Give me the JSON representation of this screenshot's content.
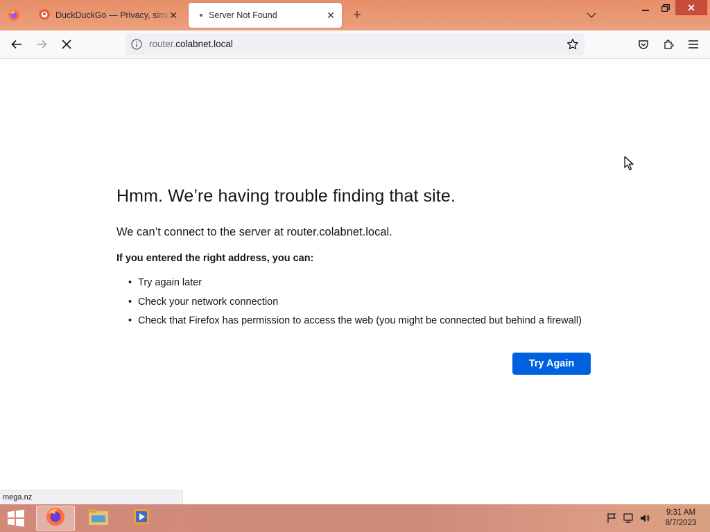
{
  "browser": {
    "tabs": [
      {
        "title": "DuckDuckGo — Privacy, simplified.",
        "active": false
      },
      {
        "title": "Server Not Found",
        "active": true
      }
    ],
    "url": {
      "host_prefix": "router.",
      "host_main": "colabnet.local"
    }
  },
  "error_page": {
    "title": "Hmm. We’re having trouble finding that site.",
    "short_desc": "We can’t connect to the server at router.colabnet.local.",
    "hint": "If you entered the right address, you can:",
    "suggestions": [
      "Try again later",
      "Check your network connection",
      "Check that Firefox has permission to access the web (you might be connected but behind a firewall)"
    ],
    "try_again_label": "Try Again"
  },
  "status_panel": {
    "text": "mega.nz"
  },
  "taskbar": {
    "clock_time": "9:31 AM",
    "clock_date": "8/7/2023"
  },
  "colors": {
    "tabstrip": "#e88f68",
    "accent": "#0061e0",
    "taskbar": "#d2897a"
  },
  "icons": [
    "firefox-menu-icon",
    "duckduckgo-icon",
    "close-icon",
    "plus-icon",
    "chevron-down-icon",
    "minimize-icon",
    "restore-icon",
    "back-icon",
    "forward-icon",
    "stop-icon",
    "info-icon",
    "star-icon",
    "pocket-icon",
    "extensions-icon",
    "hamburger-icon",
    "windows-start-icon",
    "firefox-icon",
    "file-explorer-icon",
    "media-player-icon",
    "flag-icon",
    "network-icon",
    "volume-icon"
  ]
}
